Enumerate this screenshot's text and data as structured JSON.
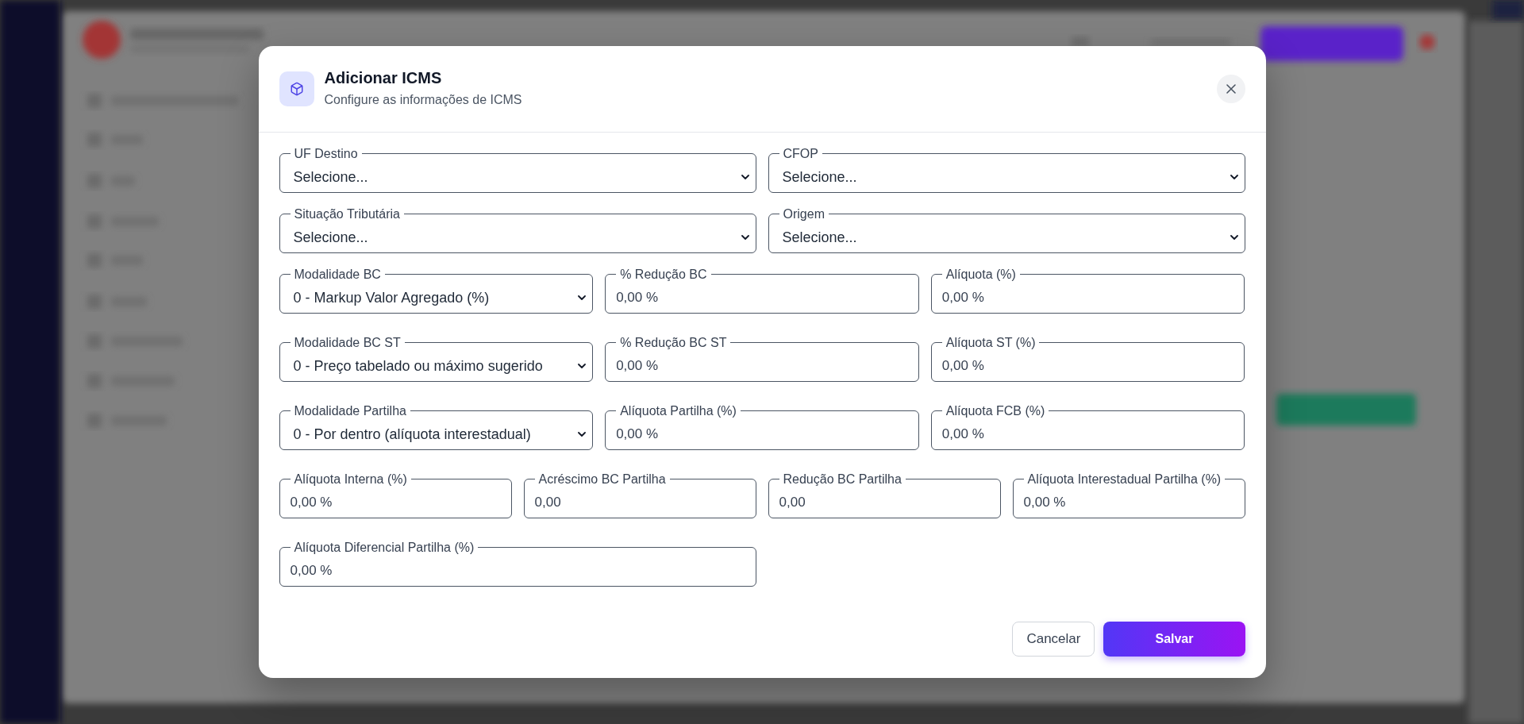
{
  "dialog": {
    "title": "Adicionar ICMS",
    "subtitle": "Configure as informações de ICMS"
  },
  "form": {
    "rows": [
      {
        "fields": [
          {
            "kind": "select",
            "label": "UF Destino",
            "value": "Selecione..."
          },
          {
            "kind": "select",
            "label": "CFOP",
            "value": "Selecione..."
          }
        ]
      },
      {
        "fields": [
          {
            "kind": "select",
            "label": "Situação Tributária",
            "value": "Selecione..."
          },
          {
            "kind": "select",
            "label": "Origem",
            "value": "Selecione..."
          }
        ]
      },
      {
        "fields": [
          {
            "kind": "select",
            "label": "Modalidade BC",
            "value": "0 - Markup Valor Agregado (%)"
          },
          {
            "kind": "input",
            "label": "% Redução BC",
            "value": "0,00 %"
          },
          {
            "kind": "input",
            "label": "Alíquota (%)",
            "value": "0,00 %"
          }
        ]
      },
      {
        "fields": [
          {
            "kind": "select",
            "label": "Modalidade BC ST",
            "value": "0 - Preço tabelado ou máximo sugerido"
          },
          {
            "kind": "input",
            "label": "% Redução BC ST",
            "value": "0,00 %"
          },
          {
            "kind": "input",
            "label": "Alíquota ST (%)",
            "value": "0,00 %"
          }
        ]
      },
      {
        "fields": [
          {
            "kind": "select",
            "label": "Modalidade Partilha",
            "value": "0 - Por dentro (alíquota interestadual)"
          },
          {
            "kind": "input",
            "label": "Alíquota Partilha (%)",
            "value": "0,00 %"
          },
          {
            "kind": "input",
            "label": "Alíquota FCB (%)",
            "value": "0,00 %"
          }
        ]
      },
      {
        "fields": [
          {
            "kind": "input",
            "label": "Alíquota Interna (%)",
            "value": "0,00 %"
          },
          {
            "kind": "input",
            "label": "Acréscimo BC Partilha",
            "value": "0,00"
          },
          {
            "kind": "input",
            "label": "Redução BC Partilha",
            "value": "0,00"
          },
          {
            "kind": "input",
            "label": "Alíquota Interestadual Partilha (%)",
            "value": "0,00 %"
          }
        ]
      },
      {
        "fields": [
          {
            "kind": "input",
            "label": "Alíquota Diferencial Partilha (%)",
            "value": "0,00 %"
          }
        ]
      }
    ]
  },
  "buttons": [
    {
      "kind": "secondary",
      "label": "Cancelar"
    },
    {
      "kind": "primary",
      "label": "Salvar"
    }
  ]
}
